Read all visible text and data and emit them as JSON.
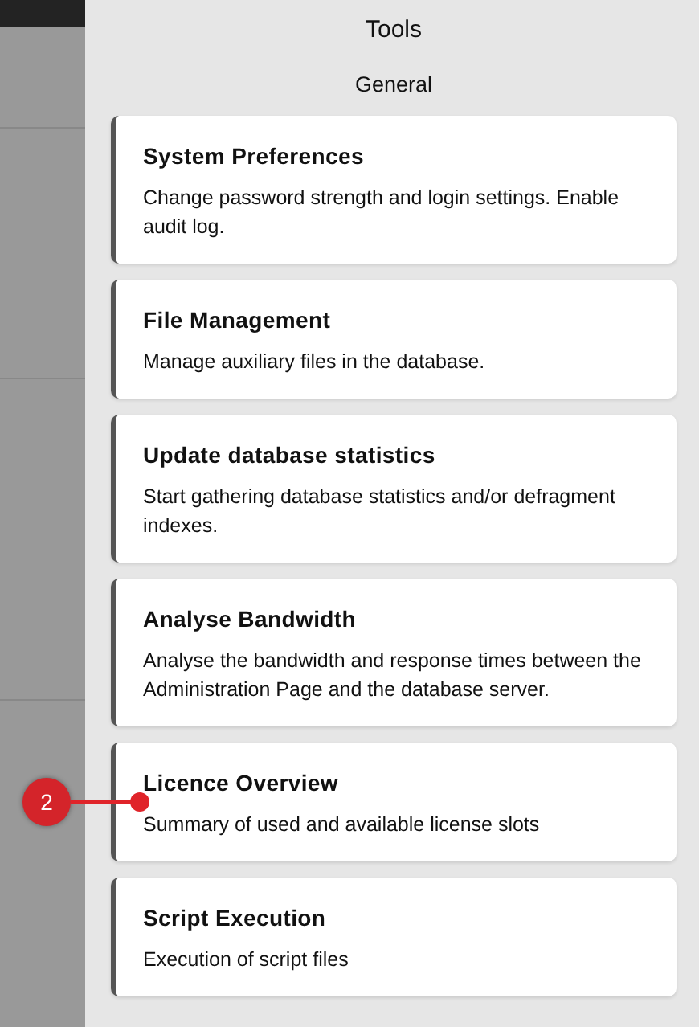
{
  "panel": {
    "title": "Tools",
    "section": "General"
  },
  "tools": [
    {
      "title": "System Preferences",
      "description": "Change password strength and login settings. Enable audit log."
    },
    {
      "title": "File Management",
      "description": "Manage auxiliary files in the database."
    },
    {
      "title": "Update database statistics",
      "description": "Start gathering database statistics and/or defragment indexes."
    },
    {
      "title": "Analyse Bandwidth",
      "description": "Analyse the bandwidth and response times between the Administration Page and the database server."
    },
    {
      "title": "Licence Overview",
      "description": "Summary of used and available license slots",
      "callout": "2"
    },
    {
      "title": "Script Execution",
      "description": "Execution of script files"
    }
  ]
}
